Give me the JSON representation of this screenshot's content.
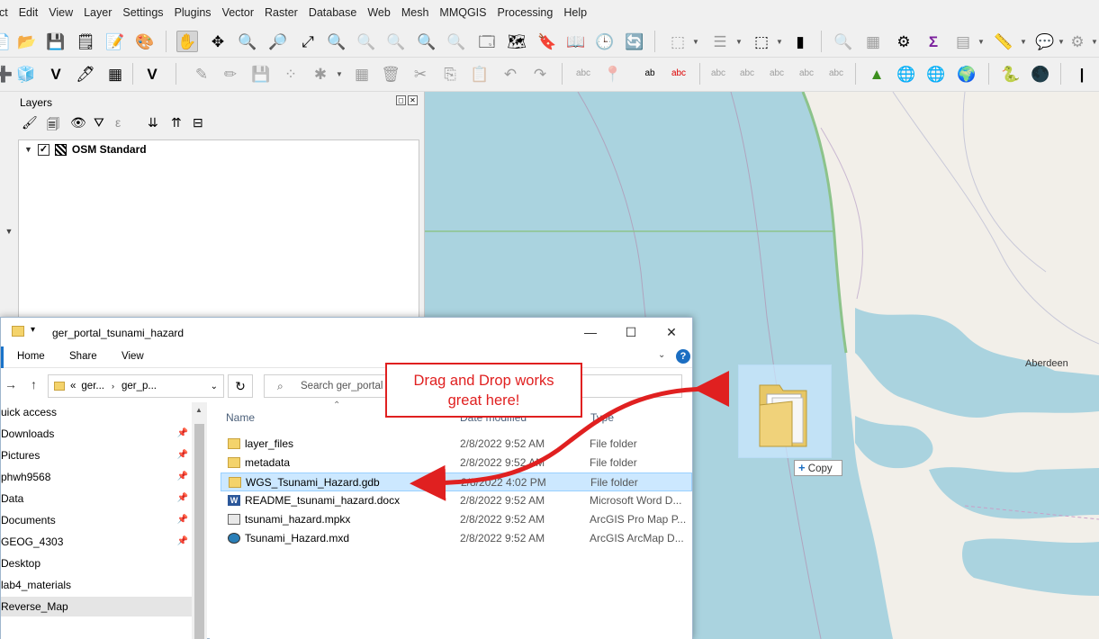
{
  "menubar": {
    "items": [
      "ect",
      "Edit",
      "View",
      "Layer",
      "Settings",
      "Plugins",
      "Vector",
      "Raster",
      "Database",
      "Web",
      "Mesh",
      "MMQGIS",
      "Processing",
      "Help"
    ]
  },
  "layers_panel": {
    "title": "Layers",
    "layers": [
      {
        "name": "OSM Standard",
        "checked": true
      }
    ]
  },
  "map": {
    "place_label": "Aberdeen",
    "colors": {
      "water": "#aad3df",
      "land": "#f2efe9",
      "coast": "#b5d3b0"
    }
  },
  "explorer": {
    "title": "ger_portal_tsunami_hazard",
    "ribbon_tabs": [
      "Home",
      "Share",
      "View"
    ],
    "address": {
      "seg1": "ger...",
      "seg2": "ger_p...",
      "prefix": "«"
    },
    "search_placeholder": "Search ger_portal",
    "nav_items": [
      {
        "label": "uick access",
        "pinned": false
      },
      {
        "label": "Downloads",
        "pinned": true
      },
      {
        "label": "Pictures",
        "pinned": true
      },
      {
        "label": "phwh9568",
        "pinned": true
      },
      {
        "label": "Data",
        "pinned": true
      },
      {
        "label": "Documents",
        "pinned": true
      },
      {
        "label": "GEOG_4303",
        "pinned": true
      },
      {
        "label": "Desktop",
        "pinned": false
      },
      {
        "label": "lab4_materials",
        "pinned": false
      },
      {
        "label": "Reverse_Map",
        "pinned": false
      }
    ],
    "columns": {
      "name": "Name",
      "date": "Date modified",
      "type": "Type"
    },
    "files": [
      {
        "name": "layer_files",
        "date": "2/8/2022 9:52 AM",
        "type": "File folder",
        "icon": "folder-icon"
      },
      {
        "name": "metadata",
        "date": "2/8/2022 9:52 AM",
        "type": "File folder",
        "icon": "folder-icon"
      },
      {
        "name": "WGS_Tsunami_Hazard.gdb",
        "date": "2/8/2022 4:02 PM",
        "type": "File folder",
        "icon": "folder-icon"
      },
      {
        "name": "README_tsunami_hazard.docx",
        "date": "2/8/2022 9:52 AM",
        "type": "Microsoft Word D...",
        "icon": "word-icon"
      },
      {
        "name": "tsunami_hazard.mpkx",
        "date": "2/8/2022 9:52 AM",
        "type": "ArcGIS Pro Map P...",
        "icon": "mpkx-icon"
      },
      {
        "name": "Tsunami_Hazard.mxd",
        "date": "2/8/2022 9:52 AM",
        "type": "ArcGIS ArcMap D...",
        "icon": "mxd-icon"
      }
    ]
  },
  "drag": {
    "copy_label": "Copy",
    "copy_glyph": "+"
  },
  "annotation": {
    "line1": "Drag and Drop works",
    "line2": "great here!",
    "color": "#e02020"
  }
}
